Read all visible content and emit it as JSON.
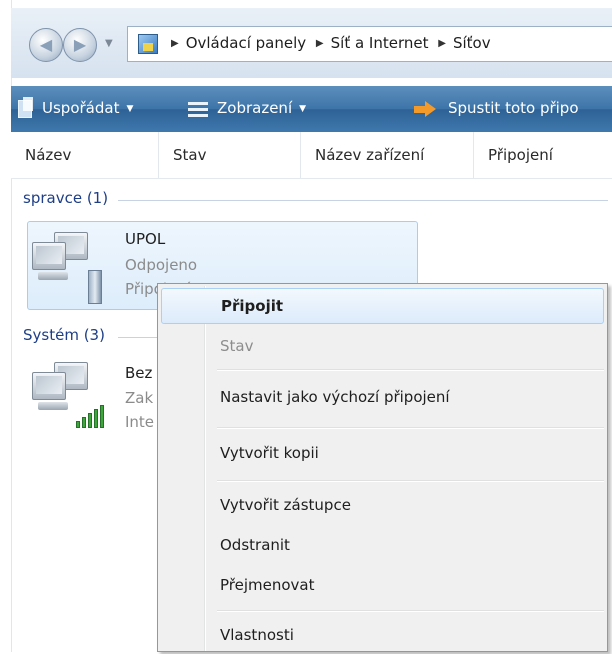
{
  "address": {
    "breadcrumbs": [
      "Ovládací panely",
      "Síť a Internet",
      "Síťov"
    ]
  },
  "toolbar": {
    "organize": "Uspořádat",
    "views": "Zobrazení",
    "start": "Spustit toto připo"
  },
  "columns": [
    "Název",
    "Stav",
    "Název zařízení",
    "Připojení"
  ],
  "groups": [
    {
      "label": "spravce (1)",
      "items": [
        {
          "name": "UPOL",
          "status": "Odpojeno",
          "detail": "Připojení"
        }
      ]
    },
    {
      "label": "Systém (3)",
      "items": [
        {
          "name": "Bez",
          "status": "Zak",
          "detail": "Inte"
        }
      ]
    }
  ],
  "context_menu": {
    "items": [
      "Připojit",
      "Stav",
      "Nastavit jako výchozí připojení",
      "Vytvořit kopii",
      "Vytvořit zástupce",
      "Odstranit",
      "Přejmenovat",
      "Vlastnosti"
    ]
  },
  "colors": {
    "toolbar_blue": "#3d74a8",
    "group_label": "#1e3f87",
    "selection": "#ddedfb",
    "signal_green": "#3ea63b"
  }
}
